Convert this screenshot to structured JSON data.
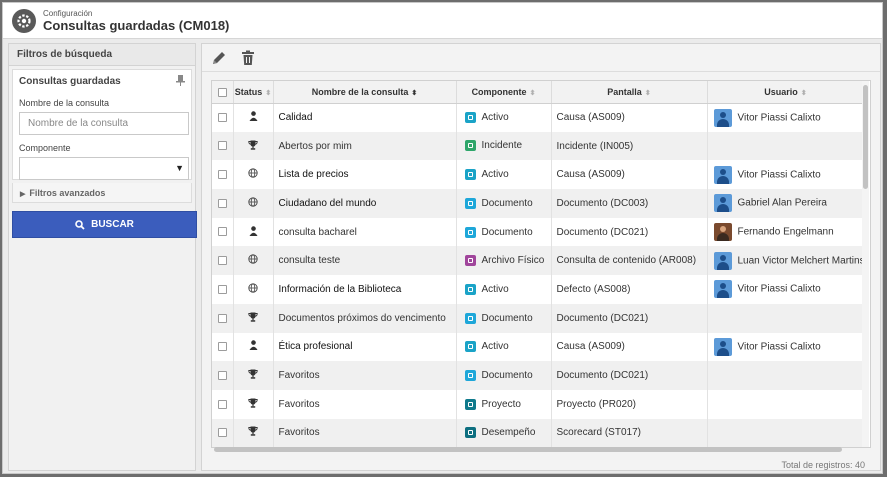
{
  "header": {
    "breadcrumb": "Configuración",
    "title": "Consultas guardadas (CM018)"
  },
  "sidebar": {
    "heading": "Filtros de búsqueda",
    "saved_queries_label": "Consultas guardadas",
    "name_field_label": "Nombre de la consulta",
    "name_field_placeholder": "Nombre de la consulta",
    "component_field_label": "Componente",
    "component_field_value": "",
    "advanced_filters_label": "Filtros avanzados",
    "search_button_label": "BUSCAR"
  },
  "toolbar": {
    "edit_icon": "pencil-icon",
    "delete_icon": "trash-icon"
  },
  "table": {
    "columns": {
      "status": "Status",
      "name": "Nombre de la consulta",
      "component": "Componente",
      "screen": "Pantalla",
      "user": "Usuario"
    },
    "rows": [
      {
        "status": "user",
        "name": "Calidad",
        "bold": true,
        "component": "Activo",
        "component_color": "#1aa3c7",
        "screen": "Causa (AS009)",
        "user": "Vitor Piassi Calixto",
        "avatar": "default"
      },
      {
        "status": "trophy",
        "name": "Abertos por mim",
        "bold": false,
        "component": "Incidente",
        "component_color": "#2ea66a",
        "screen": "Incidente (IN005)",
        "user": "",
        "avatar": ""
      },
      {
        "status": "globe",
        "name": "Lista de precios",
        "bold": true,
        "component": "Activo",
        "component_color": "#1aa3c7",
        "screen": "Causa (AS009)",
        "user": "Vitor Piassi Calixto",
        "avatar": "default"
      },
      {
        "status": "globe",
        "name": "Ciudadano del mundo",
        "bold": true,
        "component": "Documento",
        "component_color": "#1ea7d9",
        "screen": "Documento (DC003)",
        "user": "Gabriel Alan Pereira",
        "avatar": "default"
      },
      {
        "status": "user",
        "name": "consulta bacharel",
        "bold": false,
        "component": "Documento",
        "component_color": "#1ea7d9",
        "screen": "Documento (DC021)",
        "user": "Fernando Engelmann",
        "avatar": "photo"
      },
      {
        "status": "globe",
        "name": "consulta teste",
        "bold": false,
        "component": "Archivo Físico",
        "component_color": "#a0459b",
        "screen": "Consulta de contenido (AR008)",
        "user": "Luan Victor Melchert Martins",
        "avatar": "default"
      },
      {
        "status": "globe",
        "name": "Información de la Biblioteca",
        "bold": true,
        "component": "Activo",
        "component_color": "#1aa3c7",
        "screen": "Defecto (AS008)",
        "user": "Vitor Piassi Calixto",
        "avatar": "default"
      },
      {
        "status": "trophy",
        "name": "Documentos próximos do vencimento",
        "bold": false,
        "component": "Documento",
        "component_color": "#1ea7d9",
        "screen": "Documento (DC021)",
        "user": "",
        "avatar": ""
      },
      {
        "status": "user",
        "name": "Ética profesional",
        "bold": true,
        "component": "Activo",
        "component_color": "#1aa3c7",
        "screen": "Causa (AS009)",
        "user": "Vitor Piassi Calixto",
        "avatar": "default"
      },
      {
        "status": "trophy",
        "name": "Favoritos",
        "bold": false,
        "component": "Documento",
        "component_color": "#1ea7d9",
        "screen": "Documento (DC021)",
        "user": "",
        "avatar": ""
      },
      {
        "status": "trophy",
        "name": "Favoritos",
        "bold": false,
        "component": "Proyecto",
        "component_color": "#0f7a8c",
        "screen": "Proyecto (PR020)",
        "user": "",
        "avatar": ""
      },
      {
        "status": "trophy",
        "name": "Favoritos",
        "bold": false,
        "component": "Desempeño",
        "component_color": "#0d6f80",
        "screen": "Scorecard (ST017)",
        "user": "",
        "avatar": ""
      }
    ]
  },
  "footer": {
    "total_records": "Total de registros: 40"
  }
}
